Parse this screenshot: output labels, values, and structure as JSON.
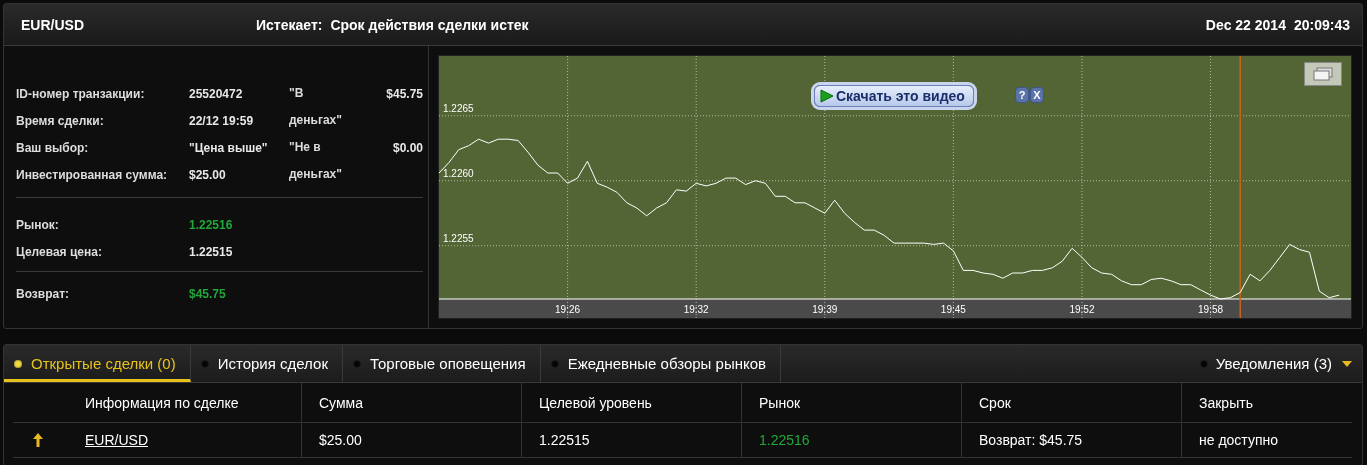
{
  "header": {
    "symbol": "EUR/USD",
    "expiry_label": "Истекает:",
    "expiry_value": "Срок действия сделки истек",
    "date": "Dec 22 2014",
    "time": "20:09:43"
  },
  "details": {
    "rows": [
      {
        "label": "ID-номер транзакции:",
        "value": "25520472"
      },
      {
        "label": "Время сделки:",
        "value": "22/12 19:59"
      },
      {
        "label": "Ваш выбор:",
        "value": "\"Цена выше\""
      },
      {
        "label": "Инвестированная сумма:",
        "value": "$25.00"
      }
    ],
    "outcomes": [
      {
        "label": "\"В деньгах\"",
        "amount": "$45.75"
      },
      {
        "label": "\"Не в деньгах\"",
        "amount": "$0.00"
      }
    ],
    "market": [
      {
        "label": "Рынок:",
        "value": "1.22516",
        "highlight": true
      },
      {
        "label": "Целевая цена:",
        "value": "1.22515",
        "highlight": false
      }
    ],
    "payout": {
      "label": "Возврат:",
      "value": "$45.75",
      "highlight": true
    }
  },
  "chart": {
    "download_bar": {
      "label": "Скачать это видео",
      "help": "?",
      "close": "X"
    },
    "chart_data": {
      "type": "line",
      "grid": true,
      "ylim": [
        1.22509,
        1.22696
      ],
      "categories": [
        null,
        null,
        null,
        null,
        null,
        null,
        null,
        null,
        null,
        null,
        null,
        null,
        null,
        "19:26",
        null,
        null,
        null,
        null,
        null,
        null,
        null,
        null,
        null,
        null,
        null,
        null,
        "19:32",
        null,
        null,
        null,
        null,
        null,
        null,
        null,
        null,
        null,
        null,
        null,
        null,
        "19:39",
        null,
        null,
        null,
        null,
        null,
        null,
        null,
        null,
        null,
        null,
        null,
        null,
        "19:45",
        null,
        null,
        null,
        null,
        null,
        null,
        null,
        null,
        null,
        null,
        null,
        null,
        "19:52",
        null,
        null,
        null,
        null,
        null,
        null,
        null,
        null,
        null,
        null,
        null,
        null,
        "19:58",
        null,
        null,
        null,
        null,
        null,
        null,
        null,
        null,
        null,
        null,
        null,
        null,
        null
      ],
      "yticks": [
        {
          "value": 1.2255,
          "label": "1.2255"
        },
        {
          "value": 1.226,
          "label": "1.2260"
        },
        {
          "value": 1.2265,
          "label": "1.2265"
        }
      ],
      "series": [
        {
          "color": "#ffffff",
          "values": [
            1.22606,
            1.22614,
            1.22624,
            1.22627,
            1.22632,
            1.22629,
            1.22632,
            1.22632,
            1.22631,
            1.22622,
            1.22612,
            1.22606,
            1.22606,
            1.22598,
            1.22602,
            1.22615,
            1.22598,
            1.22595,
            1.22591,
            1.22583,
            1.22579,
            1.22573,
            1.22579,
            1.22583,
            1.22593,
            1.22592,
            1.22598,
            1.22596,
            1.22598,
            1.22602,
            1.22602,
            1.22597,
            1.226,
            1.22598,
            1.22588,
            1.22588,
            1.22583,
            1.22583,
            1.22579,
            1.22575,
            1.22585,
            1.22575,
            1.22568,
            1.22562,
            1.22562,
            1.22558,
            1.22552,
            1.22552,
            1.22552,
            1.22552,
            1.22551,
            1.22552,
            1.22546,
            1.22531,
            1.22531,
            1.22529,
            1.22528,
            1.22525,
            1.22529,
            1.22529,
            1.22531,
            1.22531,
            1.22533,
            1.22538,
            1.22548,
            1.22541,
            1.22533,
            1.22529,
            1.22528,
            1.22523,
            1.2252,
            1.2252,
            1.22524,
            1.22525,
            1.22523,
            1.2252,
            1.2252,
            1.22516,
            1.22512,
            1.22509,
            1.2251,
            1.22514,
            1.22528,
            1.22523,
            1.22531,
            1.22541,
            1.22551,
            1.22547,
            1.22545,
            1.22515,
            1.2251,
            1.22512
          ]
        }
      ]
    }
  },
  "tabs": [
    {
      "label": "Открытые сделки (0)",
      "selected": true
    },
    {
      "label": "История сделок",
      "selected": false
    },
    {
      "label": "Торговые оповещения",
      "selected": false
    },
    {
      "label": "Ежедневные обзоры рынков",
      "selected": false
    }
  ],
  "notifications": {
    "label": "Уведомления (3)"
  },
  "table": {
    "columns": [
      "Информация по сделке",
      "Сумма",
      "Целевой уровень",
      "Рынок",
      "Срок",
      "Закрыть"
    ],
    "rows": [
      {
        "cells": [
          {
            "text": "EUR/USD",
            "kind": "link"
          },
          {
            "text": "$25.00",
            "kind": "text"
          },
          {
            "text": "1.22515",
            "kind": "text"
          },
          {
            "text": "1.22516",
            "kind": "positive"
          },
          {
            "text": "Возврат: $45.75",
            "kind": "text"
          },
          {
            "text": "не доступно",
            "kind": "text"
          }
        ]
      }
    ]
  }
}
